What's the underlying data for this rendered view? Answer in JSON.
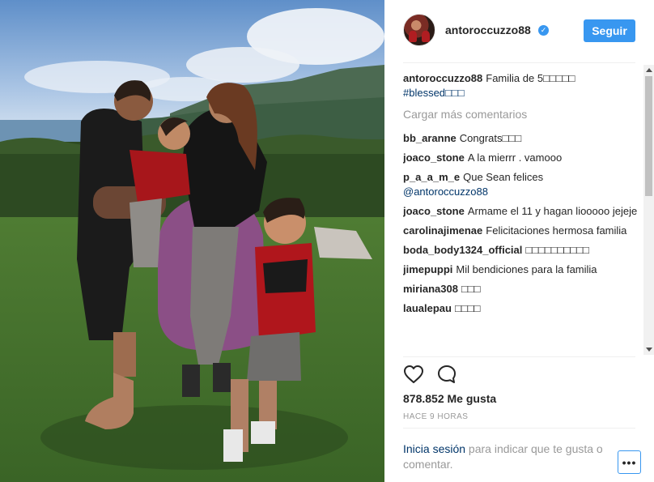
{
  "post": {
    "username": "antoroccuzzo88",
    "verified_icon": "verified-badge-icon",
    "follow_label": "Seguir",
    "caption": {
      "user": "antoroccuzzo88",
      "text": "Familia de 5□□□□□",
      "hashtag": "#blessed□□□"
    },
    "load_more_label": "Cargar más comentarios",
    "comments": [
      {
        "user": "bb_aranne",
        "text": "Congrats□□□",
        "mention": ""
      },
      {
        "user": "joaco_stone",
        "text": "A la mierrr . vamooo",
        "mention": ""
      },
      {
        "user": "p_a_a_m_e",
        "text": "Que Sean felices",
        "mention": "@antoroccuzzo88"
      },
      {
        "user": "joaco_stone",
        "text": "Armame el 11 y hagan liooooo jejeje",
        "mention": ""
      },
      {
        "user": "carolinajimenae",
        "text": "Felicitaciones hermosa familia",
        "mention": ""
      },
      {
        "user": "boda_body1324_official",
        "text": "□□□□□□□□□□",
        "mention": ""
      },
      {
        "user": "jimepuppi",
        "text": "Mil bendiciones para la familia",
        "mention": ""
      },
      {
        "user": "miriana308",
        "text": "□□□",
        "mention": ""
      },
      {
        "user": "laualepau",
        "text": "□□□□",
        "mention": ""
      }
    ],
    "likes_label": "878.852 Me gusta",
    "timestamp": "HACE 9 HORAS",
    "login": {
      "link": "Inicia sesión",
      "rest": " para indicar que te gusta o comentar."
    },
    "more_label": "•••",
    "icons": {
      "like": "heart-icon",
      "comment": "comment-bubble-icon"
    },
    "colors": {
      "accent": "#3897f0",
      "link": "#003569",
      "muted": "#999999"
    }
  }
}
